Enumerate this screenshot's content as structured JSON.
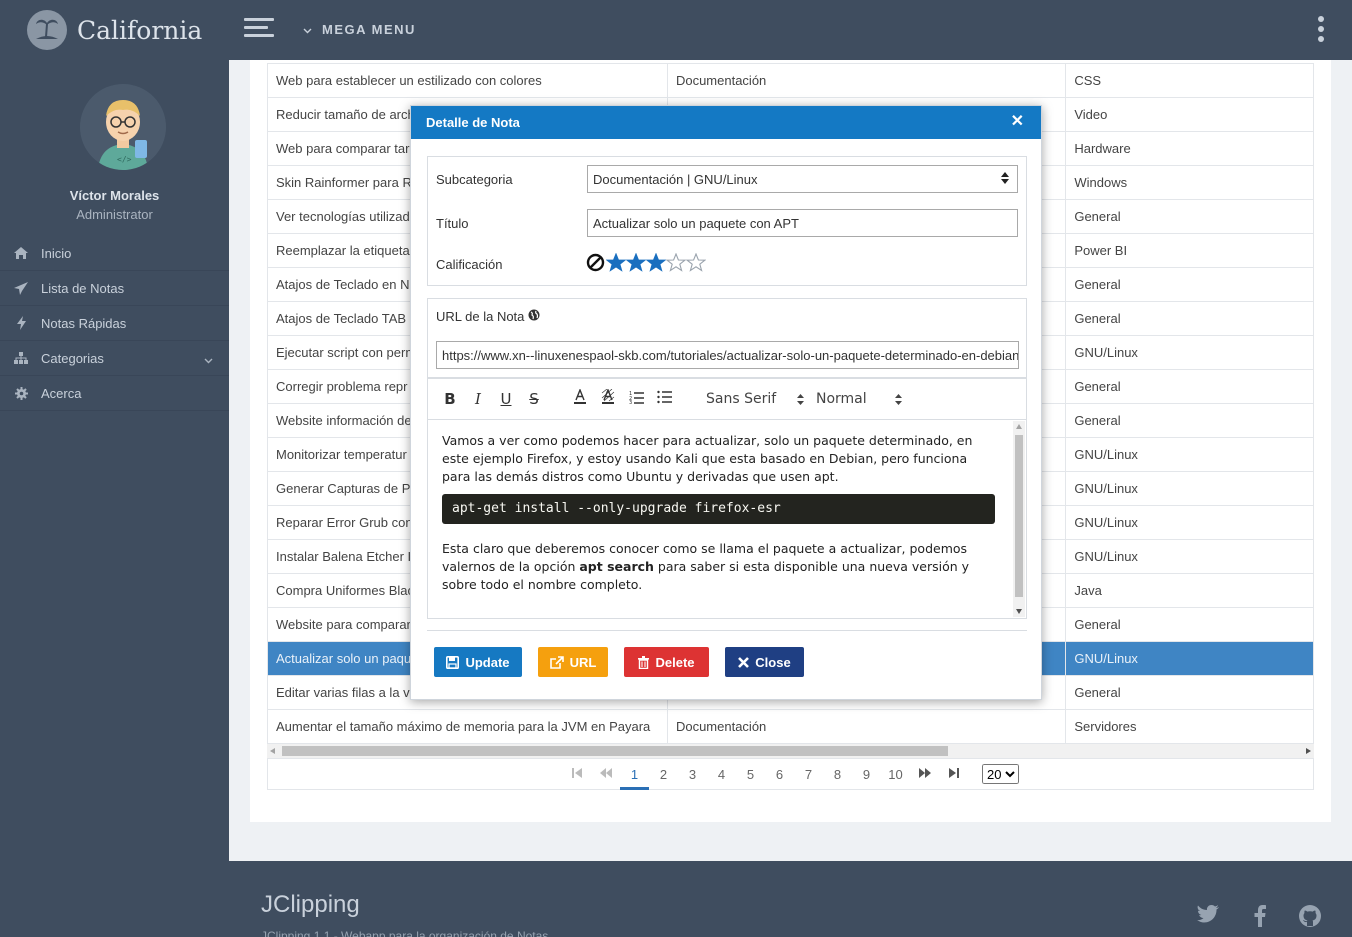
{
  "brand": {
    "name": "California"
  },
  "topbar": {
    "mega_menu": "MEGA MENU"
  },
  "user": {
    "name": "Víctor Morales",
    "role": "Administrator"
  },
  "sidebar": {
    "items": [
      {
        "label": "Inicio",
        "icon": "home-icon"
      },
      {
        "label": "Lista de Notas",
        "icon": "paper-plane-icon"
      },
      {
        "label": "Notas Rápidas",
        "icon": "bolt-icon"
      },
      {
        "label": "Categorias",
        "icon": "sitemap-icon"
      },
      {
        "label": "Acerca",
        "icon": "gear-icon"
      }
    ]
  },
  "table": {
    "rows": [
      [
        "Web para establecer un estilizado con colores",
        "Documentación",
        "CSS"
      ],
      [
        "Reducir tamaño de arch",
        "",
        "Video"
      ],
      [
        "Web para comparar tar",
        "",
        "Hardware"
      ],
      [
        "Skin Rainformer para R",
        "",
        "Windows"
      ],
      [
        "Ver tecnologías utilizad",
        "",
        "General"
      ],
      [
        "Reemplazar la etiqueta",
        "",
        "Power BI"
      ],
      [
        "Atajos de Teclado en Ne",
        "",
        "General"
      ],
      [
        "Atajos de Teclado TAB J",
        "",
        "General"
      ],
      [
        "Ejecutar script con perm",
        "",
        "GNU/Linux"
      ],
      [
        "Corregir problema repr",
        "",
        "General"
      ],
      [
        "Website información de",
        "",
        "General"
      ],
      [
        "Monitorizar temperatur",
        "",
        "GNU/Linux"
      ],
      [
        "Generar Capturas de Pa",
        "",
        "GNU/Linux"
      ],
      [
        "Reparar Error Grub con",
        "",
        "GNU/Linux"
      ],
      [
        "Instalar Balena Etcher I",
        "",
        "GNU/Linux"
      ],
      [
        "Compra Uniformes Blac",
        "",
        "Java"
      ],
      [
        "Website para comparar",
        "",
        "General"
      ],
      [
        "Actualizar solo un paqu",
        "",
        "GNU/Linux"
      ],
      [
        "Editar varias filas a la ve",
        "",
        "General"
      ],
      [
        "Aumentar el tamaño máximo de memoria para la JVM en Payara",
        "Documentación",
        "Servidores"
      ]
    ],
    "selected_row": 17
  },
  "pager": {
    "pages": [
      "1",
      "2",
      "3",
      "4",
      "5",
      "6",
      "7",
      "8",
      "9",
      "10"
    ],
    "current": "1",
    "page_size": "20"
  },
  "footer": {
    "title": "JClipping",
    "subtitle": "JClipping 1.1 - Webapp para la organización de Notas"
  },
  "modal": {
    "title": "Detalle de Nota",
    "subcategoria_label": "Subcategoria",
    "subcategoria_value": "Documentación | GNU/Linux",
    "titulo_label": "Título",
    "titulo_value": "Actualizar solo un paquete con APT",
    "calificacion_label": "Calificación",
    "rating": 3,
    "rating_max": 5,
    "url_label": "URL de la Nota",
    "url_value": "https://www.xn--linuxenespaol-skb.com/tutoriales/actualizar-solo-un-paquete-determinado-en-debian/",
    "font_select": "Sans Serif",
    "size_select": "Normal",
    "editor": {
      "p1": "Vamos a ver como podemos hacer para actualizar, solo un paquete determinado, en este ejemplo Firefox, y estoy usando Kali que esta basado en Debian, pero funciona para las demás distros como Ubuntu y derivadas que usen apt.",
      "code": "apt-get install --only-upgrade firefox-esr",
      "p2_a": "Esta claro que deberemos conocer como se llama el paquete a actualizar, podemos valernos de la opción ",
      "p2_b": "apt search",
      "p2_c": " para saber si esta disponible una nueva versión y sobre todo el nombre completo."
    },
    "buttons": {
      "update": "Update",
      "url": "URL",
      "delete": "Delete",
      "close": "Close"
    },
    "colors": {
      "update": "#1679c2",
      "url": "#f5a00e",
      "delete": "#dd3333",
      "close": "#1f3f83",
      "header": "#1479c4"
    }
  }
}
